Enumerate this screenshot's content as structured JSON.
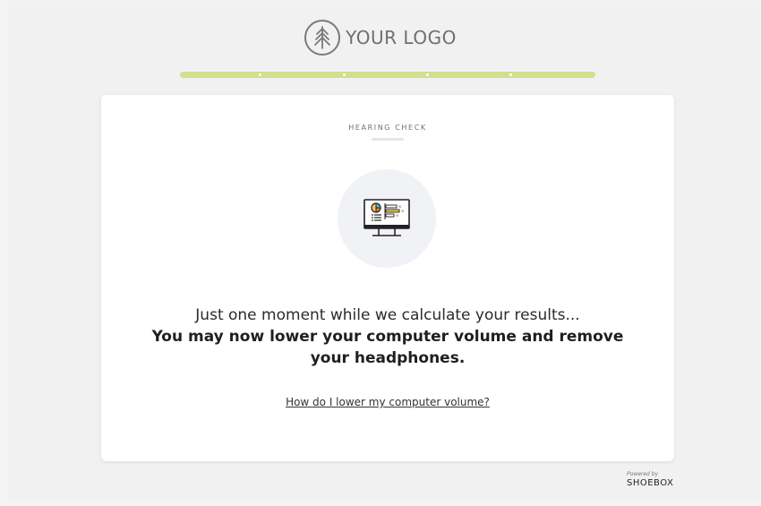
{
  "header": {
    "logo_text": "YOUR LOGO",
    "logo_icon": "tree-icon"
  },
  "progress": {
    "completion": 1.0,
    "steps": 5,
    "color": "#cfe08f"
  },
  "card": {
    "eyebrow": "HEARING CHECK",
    "illustration_icon": "computer-monitor-chart-icon",
    "message_line1": "Just one moment while we calculate your results...",
    "message_line2": "You may now lower your computer volume and remove your headphones.",
    "help_link": "How do I lower my computer volume?"
  },
  "footer": {
    "powered_by": "Powered by",
    "brand": "SHOEBOX"
  }
}
